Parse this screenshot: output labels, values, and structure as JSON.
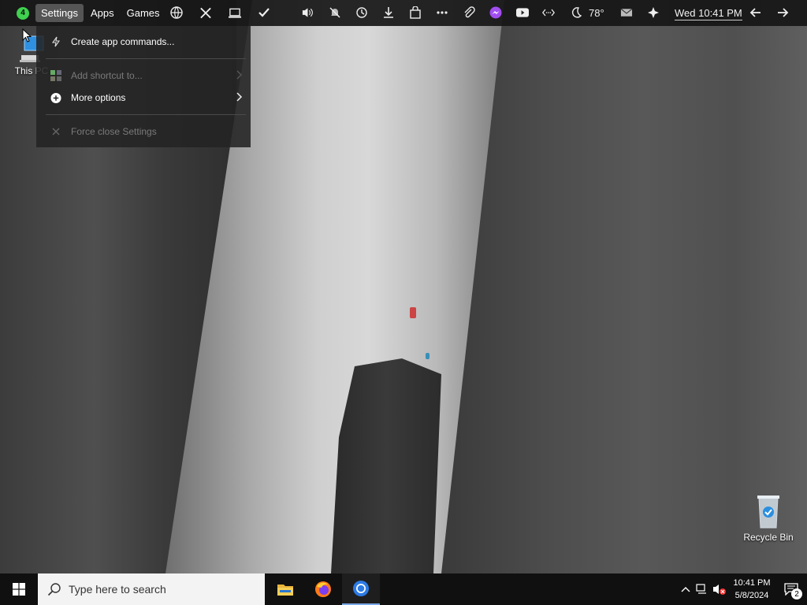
{
  "topbar": {
    "badge_count": "4",
    "menu": [
      "Settings",
      "Apps",
      "Games"
    ],
    "weather": "78°",
    "datetime": "Wed 10:41 PM",
    "icons": [
      "globe-icon",
      "tools-icon",
      "laptop-icon",
      "check-icon",
      "volume-icon",
      "mute-bell-icon",
      "history-icon",
      "download-icon",
      "bag-icon",
      "more-icon",
      "paperclip-icon",
      "messenger-icon",
      "youtube-icon",
      "code-icon",
      "moon-icon",
      "mail-icon",
      "sparkle-icon",
      "back-arrow-icon",
      "forward-arrow-icon"
    ]
  },
  "dropdown": {
    "items": [
      {
        "label": "Create app commands...",
        "icon": "bolt-icon",
        "disabled": false
      },
      {
        "label": "Add shortcut to...",
        "icon": "apps-icon",
        "disabled": true
      },
      {
        "label": "More options",
        "icon": "plus-circle-icon",
        "disabled": false
      },
      {
        "label": "Force close Settings",
        "icon": "close-icon",
        "disabled": true
      }
    ]
  },
  "desktop": {
    "this_pc": "This PC",
    "recycle_bin": "Recycle Bin"
  },
  "taskbar": {
    "search_placeholder": "Type here to search",
    "apps": [
      "file-explorer-icon",
      "firefox-icon",
      "chrome-icon"
    ],
    "time": "10:41 PM",
    "date": "5/8/2024",
    "notification_count": "2"
  }
}
